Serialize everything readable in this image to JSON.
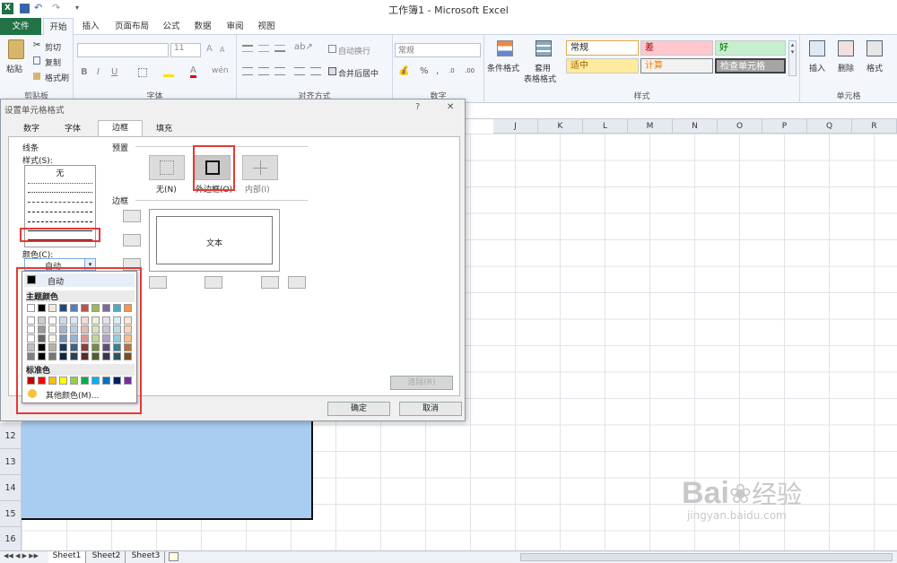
{
  "title": "工作簿1 - Microsoft Excel",
  "ribbon_tabs": [
    "文件",
    "开始",
    "插入",
    "页面布局",
    "公式",
    "数据",
    "审阅",
    "视图"
  ],
  "clipboard": {
    "paste": "粘贴",
    "cut": "剪切",
    "copy": "复制",
    "format_painter": "格式刷",
    "label": "剪贴板"
  },
  "font": {
    "size": "11",
    "label": "字体"
  },
  "alignment": {
    "wrap": "自动换行",
    "merge": "合并后居中",
    "label": "对齐方式"
  },
  "number": {
    "format": "常规",
    "label": "数字"
  },
  "styles": {
    "cond": "条件格式",
    "table_fmt": "套用",
    "table_fmt2": "表格格式",
    "normal": "常规",
    "bad": "差",
    "good": "好",
    "neutral": "适中",
    "calc": "计算",
    "check": "检查单元格",
    "label": "样式"
  },
  "cells": {
    "insert": "插入",
    "delete": "删除",
    "format": "格式",
    "label": "单元格"
  },
  "columns": [
    "J",
    "K",
    "L",
    "M",
    "N",
    "O",
    "P",
    "Q",
    "R"
  ],
  "rows": [
    "12",
    "13",
    "14",
    "15",
    "16"
  ],
  "sheets": [
    "Sheet1",
    "Sheet2",
    "Sheet3"
  ],
  "dialog": {
    "title": "设置单元格格式",
    "help": "?",
    "close": "✕",
    "tabs": [
      "数字",
      "字体",
      "边框",
      "填充"
    ],
    "line_group": "线条",
    "style_label": "样式(S):",
    "none_style": "无",
    "color_label": "颜色(C):",
    "color_value": "自动",
    "presets_label": "预置",
    "preset_none": "无(N)",
    "preset_outline": "外边框(O)",
    "preset_inside": "内部(I)",
    "border_label": "边框",
    "preview_text": "文本",
    "clear_btn": "清除(R)",
    "ok": "确定",
    "cancel": "取消"
  },
  "color_popup": {
    "auto": "自动",
    "theme_label": "主题颜色",
    "standard_label": "标准色",
    "more": "其他颜色(M)...",
    "theme_top": [
      "#ffffff",
      "#000000",
      "#eeece1",
      "#1f497d",
      "#4f81bd",
      "#c0504d",
      "#9bbb59",
      "#8064a2",
      "#4bacc6",
      "#f79646"
    ],
    "standard": [
      "#c00000",
      "#ff0000",
      "#ffc000",
      "#ffff00",
      "#92d050",
      "#00b050",
      "#00b0f0",
      "#0070c0",
      "#002060",
      "#7030a0"
    ]
  },
  "watermark": {
    "brand": "Bai",
    "brand2": "经验",
    "url": "jingyan.baidu.com"
  }
}
